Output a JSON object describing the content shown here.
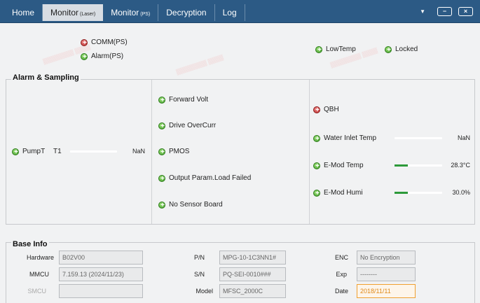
{
  "tabs": [
    {
      "label": "Home",
      "sub": ""
    },
    {
      "label": "Monitor",
      "sub": "(Laser)"
    },
    {
      "label": "Monitor",
      "sub": "(PS)"
    },
    {
      "label": "Decryption",
      "sub": ""
    },
    {
      "label": "Log",
      "sub": ""
    }
  ],
  "window": {
    "dropdown": "▼",
    "minimize": "−",
    "close": "×"
  },
  "top_status": {
    "comm_ps": "COMM(PS)",
    "alarm_ps": "Alarm(PS)",
    "low_temp": "LowTemp",
    "locked": "Locked"
  },
  "alarm_sampling": {
    "title": "Alarm & Sampling",
    "pumpt": {
      "label": "PumpT",
      "channel": "T1",
      "value": "NaN"
    },
    "center": [
      "Forward Volt",
      "Drive OverCurr",
      "PMOS",
      "Output Param.Load Failed",
      "No Sensor Board"
    ],
    "qbh": "QBH",
    "water_inlet": {
      "label": "Water Inlet Temp",
      "value": "NaN",
      "level": 0
    },
    "emod_temp": {
      "label": "E-Mod Temp",
      "value": "28.3°C",
      "level": 0.28
    },
    "emod_humi": {
      "label": "E-Mod Humi",
      "value": "30.0%",
      "level": 0.28
    }
  },
  "base_info": {
    "title": "Base Info",
    "hardware": {
      "label": "Hardware",
      "value": "B02V00"
    },
    "mmcu": {
      "label": "MMCU",
      "value": "7.159.13 (2024/11/23)"
    },
    "smcu": {
      "label": "SMCU",
      "value": ""
    },
    "pn": {
      "label": "P/N",
      "value": "MPG-10-1C3NN1#"
    },
    "sn": {
      "label": "S/N",
      "value": "PQ-SEI-0010###"
    },
    "model": {
      "label": "Model",
      "value": "MFSC_2000C"
    },
    "enc": {
      "label": "ENC",
      "value": "No Encryption"
    },
    "exp": {
      "label": "Exp",
      "value": "--------"
    },
    "date": {
      "label": "Date",
      "value": "2018/11/11"
    }
  },
  "colors": {
    "tabbar": "#2c5a85",
    "led_green": "#3f9a27",
    "led_red": "#b62727",
    "bar_fill": "#2d9a3a",
    "date_highlight": "#f0a030"
  }
}
